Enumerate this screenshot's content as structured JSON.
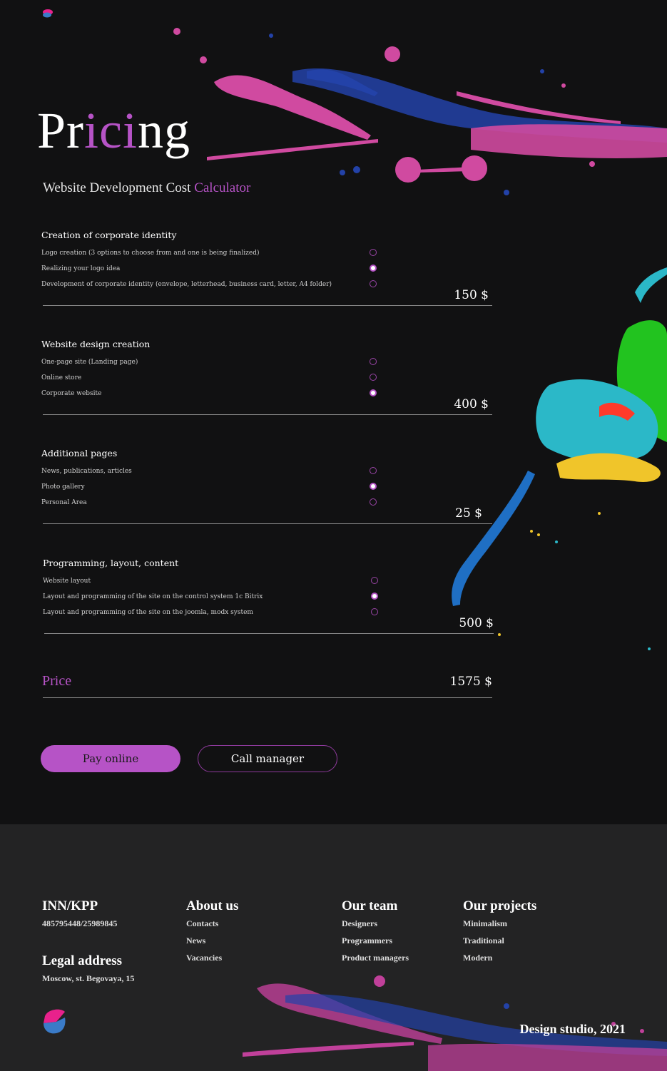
{
  "title_parts": [
    "Pr",
    "ici",
    "ng"
  ],
  "subtitle_plain": "Website Development Cost",
  "subtitle_accent": "Calculator",
  "sections": [
    {
      "title": "Creation of corporate identity",
      "options": [
        {
          "label": "Logo creation (3 options to choose from and one is being finalized)",
          "selected": false
        },
        {
          "label": "Realizing your logo idea",
          "selected": true
        },
        {
          "label": "Development of corporate identity (envelope, letterhead, business card, letter, A4 folder)",
          "selected": false
        }
      ],
      "sum": "150 $"
    },
    {
      "title": "Website design creation",
      "options": [
        {
          "label": "One-page site (Landing page)",
          "selected": false
        },
        {
          "label": "Online store",
          "selected": false
        },
        {
          "label": "Corporate website",
          "selected": true
        }
      ],
      "sum": "400 $"
    },
    {
      "title": "Additional pages",
      "options": [
        {
          "label": "News, publications, articles",
          "selected": false
        },
        {
          "label": "Photo gallery",
          "selected": true
        },
        {
          "label": "Personal Area",
          "selected": false
        }
      ],
      "sum": "25 $"
    },
    {
      "title": "Programming, layout, content",
      "options": [
        {
          "label": "Website layout",
          "selected": false
        },
        {
          "label": "Layout and programming of the site on the control system 1c Bitrix",
          "selected": true
        },
        {
          "label": "Layout and programming of the site on the joomla, modx system",
          "selected": false
        }
      ],
      "sum": "500 $"
    }
  ],
  "price": {
    "label": "Price",
    "value": "1575 $"
  },
  "buttons": {
    "pay": "Pay online",
    "call": "Call manager"
  },
  "footer": {
    "inn_title": "INN/KPP",
    "inn_value": "485795448/25989845",
    "legal_title": "Legal address",
    "legal_value": "Moscow, st. Begovaya, 15",
    "about": {
      "title": "About us",
      "items": [
        "Contacts",
        "News",
        "Vacancies"
      ]
    },
    "team": {
      "title": "Our team",
      "items": [
        "Designers",
        "Programmers",
        "Product managers"
      ]
    },
    "projects": {
      "title": "Our projects",
      "items": [
        "Minimalism",
        "Traditional",
        "Modern"
      ]
    },
    "copyright": "Design studio, 2021"
  },
  "colors": {
    "accent": "#b653c6",
    "background": "#111112",
    "footer_background": "#232324"
  },
  "icons": [
    "logo-icon",
    "radio-icon"
  ]
}
